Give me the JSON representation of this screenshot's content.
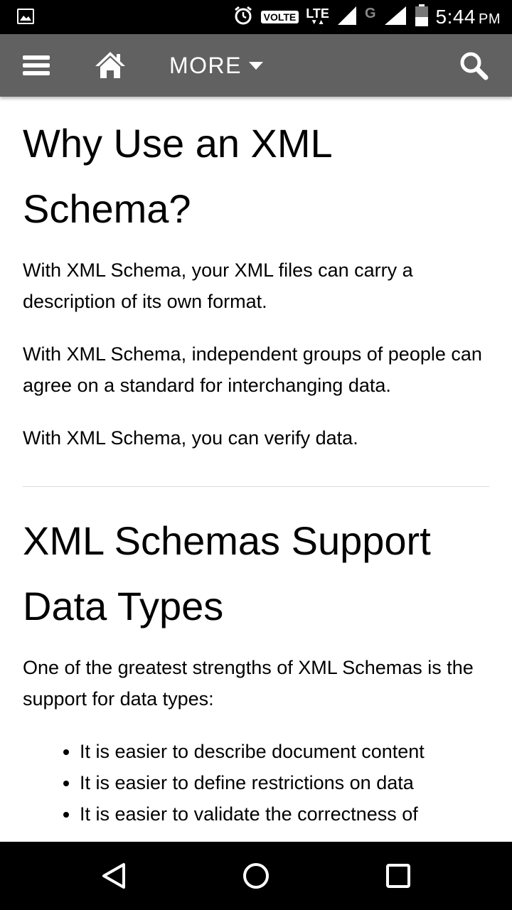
{
  "status_bar": {
    "volte": "VOLTE",
    "lte": "LTE",
    "network_g": "G",
    "time": "5:44",
    "ampm": "PM"
  },
  "nav": {
    "more_label": "MORE"
  },
  "content": {
    "section1": {
      "title": "Why Use an XML Schema?",
      "paragraphs": [
        "With XML Schema, your XML files can carry a description of its own format.",
        "With XML Schema, independent groups of people can agree on a standard for interchanging data.",
        "With XML Schema, you can verify data."
      ]
    },
    "section2": {
      "title": "XML Schemas Support Data Types",
      "intro": "One of the greatest strengths of XML Schemas is the support for data types:",
      "bullets": [
        "It is easier to describe document content",
        "It is easier to define restrictions on data",
        "It is easier to validate the correctness of"
      ]
    }
  },
  "icons": {
    "status": [
      "gallery-icon",
      "alarm-icon",
      "signal-icon",
      "battery-icon"
    ],
    "nav": [
      "menu-icon",
      "home-icon",
      "caret-down-icon",
      "search-icon"
    ],
    "system": [
      "back-icon",
      "home-circle-icon",
      "recents-icon"
    ]
  }
}
